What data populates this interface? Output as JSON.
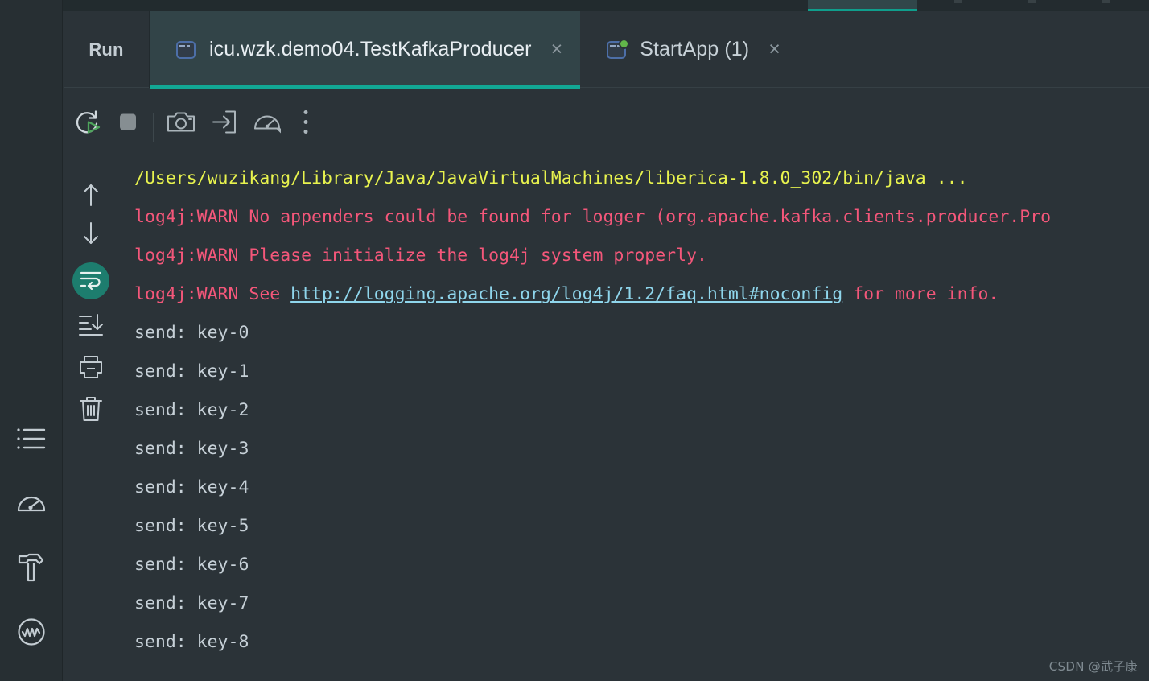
{
  "window": {
    "label": "Run",
    "accent_color": "#12a895",
    "background": "#2b3338"
  },
  "top_strip": {
    "active_tab_underline_color": "#0f9e8c"
  },
  "tabs": [
    {
      "title": "icu.wzk.demo04.TestKafkaProducer",
      "icon": "run-configuration-icon",
      "close_label": "×",
      "active": true,
      "running_indicator": false
    },
    {
      "title": "StartApp (1)",
      "icon": "run-configuration-running-icon",
      "close_label": "×",
      "active": false,
      "running_indicator": true
    }
  ],
  "toolbar": {
    "buttons": [
      {
        "name": "rerun-button",
        "icon": "rerun-icon",
        "tooltip": "Rerun"
      },
      {
        "name": "stop-button",
        "icon": "stop-icon",
        "tooltip": "Stop"
      },
      {
        "name": "screenshot-button",
        "icon": "camera-icon",
        "tooltip": "Take Screenshot"
      },
      {
        "name": "attach-button",
        "icon": "arrow-into-box-icon",
        "tooltip": "Attach"
      },
      {
        "name": "profiler-button",
        "icon": "gauge-icon",
        "tooltip": "Profiler"
      },
      {
        "name": "more-button",
        "icon": "more-vertical-icon",
        "tooltip": "More"
      }
    ]
  },
  "console_gutter": {
    "buttons": [
      {
        "name": "scroll-up-button",
        "icon": "arrow-up-icon"
      },
      {
        "name": "scroll-down-button",
        "icon": "arrow-down-icon"
      },
      {
        "name": "soft-wrap-button",
        "icon": "soft-wrap-icon",
        "active": true
      },
      {
        "name": "scroll-to-end-button",
        "icon": "scroll-to-end-icon"
      },
      {
        "name": "print-button",
        "icon": "printer-icon"
      },
      {
        "name": "clear-all-button",
        "icon": "trash-icon"
      }
    ]
  },
  "tool_sidebar": {
    "buttons": [
      {
        "name": "sidebar-item-structure",
        "icon": "list-icon"
      },
      {
        "name": "sidebar-item-profiler",
        "icon": "gauge-icon"
      },
      {
        "name": "sidebar-item-build",
        "icon": "hammer-icon"
      },
      {
        "name": "sidebar-item-monitor",
        "icon": "wave-circle-icon"
      }
    ]
  },
  "console": {
    "lines": [
      {
        "type": "cmd",
        "text": "/Users/wuzikang/Library/Java/JavaVirtualMachines/liberica-1.8.0_302/bin/java ..."
      },
      {
        "type": "warn",
        "text": "log4j:WARN No appenders could be found for logger (org.apache.kafka.clients.producer.Pro"
      },
      {
        "type": "warn",
        "text": "log4j:WARN Please initialize the log4j system properly."
      },
      {
        "type": "warn",
        "text": "log4j:WARN See ",
        "link": "http://logging.apache.org/log4j/1.2/faq.html#noconfig",
        "after": " for more info."
      },
      {
        "type": "stdout",
        "text": "send: key-0"
      },
      {
        "type": "stdout",
        "text": "send: key-1"
      },
      {
        "type": "stdout",
        "text": "send: key-2"
      },
      {
        "type": "stdout",
        "text": "send: key-3"
      },
      {
        "type": "stdout",
        "text": "send: key-4"
      },
      {
        "type": "stdout",
        "text": "send: key-5"
      },
      {
        "type": "stdout",
        "text": "send: key-6"
      },
      {
        "type": "stdout",
        "text": "send: key-7"
      },
      {
        "type": "stdout",
        "text": "send: key-8"
      }
    ],
    "colors": {
      "stdout": "#c6d0d7",
      "command": "#e8f34e",
      "warn": "#f4577a",
      "link": "#8fd6ec"
    }
  },
  "watermark": {
    "text": "CSDN @武子康"
  }
}
